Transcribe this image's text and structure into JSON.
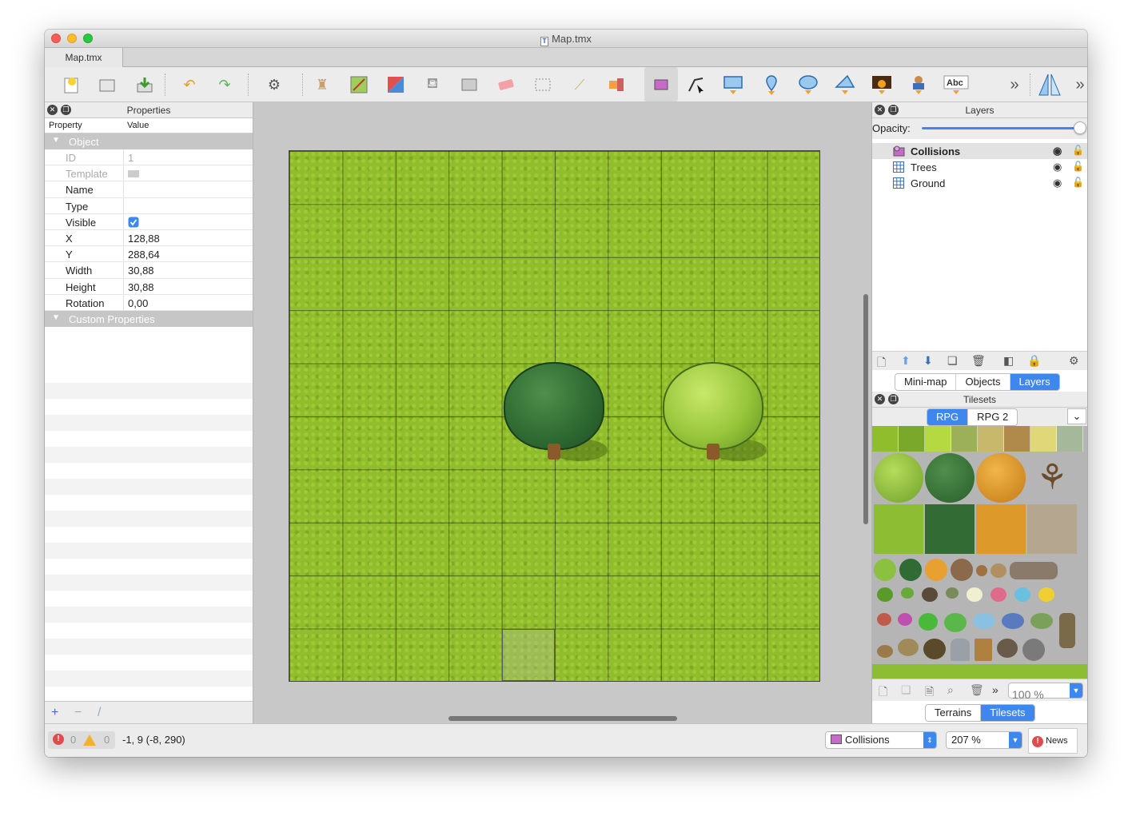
{
  "window": {
    "title": "Map.tmx"
  },
  "tabs": [
    {
      "label": "Map.tmx"
    }
  ],
  "toolbar": {
    "overflow_left": "»",
    "overflow_right": "»",
    "text_tool_label": "Abc"
  },
  "properties_panel": {
    "title": "Properties",
    "columns": {
      "property": "Property",
      "value": "Value"
    },
    "group_object": "Object",
    "group_custom": "Custom Properties",
    "rows": [
      {
        "name": "ID",
        "value": "1",
        "disabled": true
      },
      {
        "name": "Template",
        "value": "",
        "disabled": true
      },
      {
        "name": "Name",
        "value": ""
      },
      {
        "name": "Type",
        "value": ""
      },
      {
        "name": "Visible",
        "value": "checked"
      },
      {
        "name": "X",
        "value": "128,88"
      },
      {
        "name": "Y",
        "value": "288,64"
      },
      {
        "name": "Width",
        "value": "30,88"
      },
      {
        "name": "Height",
        "value": "30,88"
      },
      {
        "name": "Rotation",
        "value": "0,00"
      }
    ],
    "footer": {
      "add": "+",
      "remove": "−",
      "edit": "/"
    }
  },
  "layers_panel": {
    "title": "Layers",
    "opacity_label": "Opacity:",
    "opacity_value": 1.0,
    "layers": [
      {
        "name": "Collisions",
        "type": "object",
        "selected": true
      },
      {
        "name": "Trees",
        "type": "tile",
        "selected": false
      },
      {
        "name": "Ground",
        "type": "tile",
        "selected": false
      }
    ],
    "bottom_tabs": [
      "Mini-map",
      "Objects",
      "Layers"
    ],
    "active_bottom_tab": "Layers"
  },
  "tilesets_panel": {
    "title": "Tilesets",
    "tabs": [
      "RPG",
      "RPG 2"
    ],
    "active_tab": "RPG",
    "zoom": "100 %",
    "bottom_tabs": [
      "Terrains",
      "Tilesets"
    ],
    "active_bottom_tab": "Tilesets"
  },
  "status_bar": {
    "errors": "0",
    "warnings": "0",
    "coordinates": "-1, 9 (-8, 290)",
    "layer_combo": "Collisions",
    "zoom_combo": "207 %",
    "news_label": "News"
  },
  "colors": {
    "accent": "#3d87ef",
    "grass": "#8fbd2b",
    "error": "#e04c4c",
    "warning": "#f2b12c"
  }
}
